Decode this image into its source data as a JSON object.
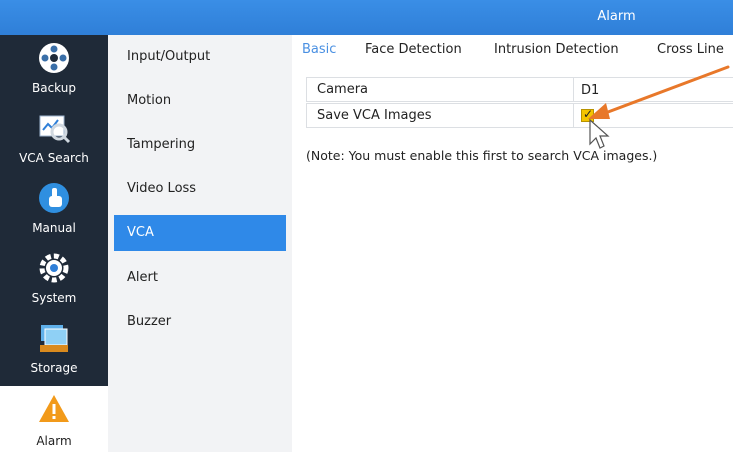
{
  "window": {
    "title": "Alarm"
  },
  "left_nav": [
    {
      "label": "Backup",
      "icon": "film-reel-icon"
    },
    {
      "label": "VCA Search",
      "icon": "magnifier-chart-icon"
    },
    {
      "label": "Manual",
      "icon": "hand-pointer-icon"
    },
    {
      "label": "System",
      "icon": "gear-icon"
    },
    {
      "label": "Storage",
      "icon": "storage-drive-icon"
    },
    {
      "label": "Alarm",
      "icon": "warning-triangle-icon",
      "active": true
    }
  ],
  "submenu": [
    {
      "label": "Input/Output"
    },
    {
      "label": "Motion"
    },
    {
      "label": "Tampering"
    },
    {
      "label": "Video Loss"
    },
    {
      "label": "VCA",
      "active": true
    },
    {
      "label": "Alert"
    },
    {
      "label": "Buzzer"
    }
  ],
  "tabs": [
    {
      "label": "Basic",
      "active": true
    },
    {
      "label": "Face Detection"
    },
    {
      "label": "Intrusion Detection"
    },
    {
      "label": "Cross Line"
    }
  ],
  "settings": {
    "camera_label": "Camera",
    "camera_value": "D1",
    "save_vca_label": "Save VCA Images",
    "save_vca_checked": true
  },
  "note": "(Note: You must enable this first to search VCA images.)",
  "colors": {
    "title_bar": "#2f7fd8",
    "nav_bg": "#1f2a38",
    "active_submenu": "#2f89e8",
    "annotation_arrow": "#e8782a",
    "checkbox_fill": "#f4c400"
  }
}
